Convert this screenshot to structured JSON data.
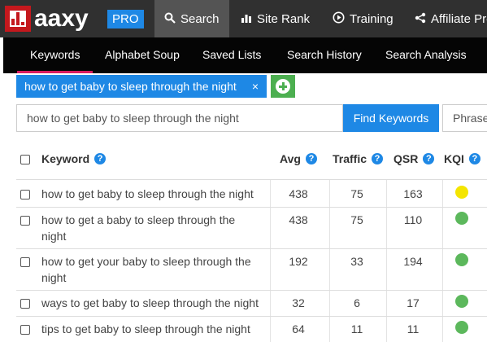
{
  "brand": {
    "name": "aaxy",
    "badge": "PRO"
  },
  "topnav": {
    "search": {
      "label": "Search",
      "icon": "search-icon"
    },
    "siterank": {
      "label": "Site Rank",
      "icon": "bar-chart-icon"
    },
    "training": {
      "label": "Training",
      "icon": "play-circle-icon"
    },
    "affiliate": {
      "label": "Affiliate Pro",
      "icon": "share-icon"
    }
  },
  "subnav": {
    "keywords": "Keywords",
    "alphabet": "Alphabet Soup",
    "saved": "Saved Lists",
    "history": "Search History",
    "analysis": "Search Analysis"
  },
  "tag": {
    "label": "how to get baby to sleep through the night",
    "close": "×"
  },
  "search": {
    "value": "how to get baby to sleep through the night",
    "find_label": "Find Keywords",
    "phrase_label": "Phrase"
  },
  "table": {
    "headers": {
      "keyword": "Keyword",
      "avg": "Avg",
      "traffic": "Traffic",
      "qsr": "QSR",
      "kqi": "KQI"
    },
    "rows": [
      {
        "keyword": "how to get baby to sleep through the night",
        "avg": "438",
        "traffic": "75",
        "qsr": "163",
        "kqi": "#f4e500"
      },
      {
        "keyword": "how to get a baby to sleep through the night",
        "avg": "438",
        "traffic": "75",
        "qsr": "110",
        "kqi": "#5cb85c"
      },
      {
        "keyword": "how to get your baby to sleep through the night",
        "avg": "192",
        "traffic": "33",
        "qsr": "194",
        "kqi": "#5cb85c"
      },
      {
        "keyword": "ways to get baby to sleep through the night",
        "avg": "32",
        "traffic": "6",
        "qsr": "17",
        "kqi": "#5cb85c"
      },
      {
        "keyword": "tips to get baby to sleep through the night",
        "avg": "64",
        "traffic": "11",
        "qsr": "11",
        "kqi": "#5cb85c"
      }
    ]
  },
  "colors": {
    "accent": "#1e88e5",
    "nav_bg": "#303030",
    "subnav_bg": "#050505",
    "active_underline": "#d81b60",
    "add_green": "#4caf50"
  }
}
